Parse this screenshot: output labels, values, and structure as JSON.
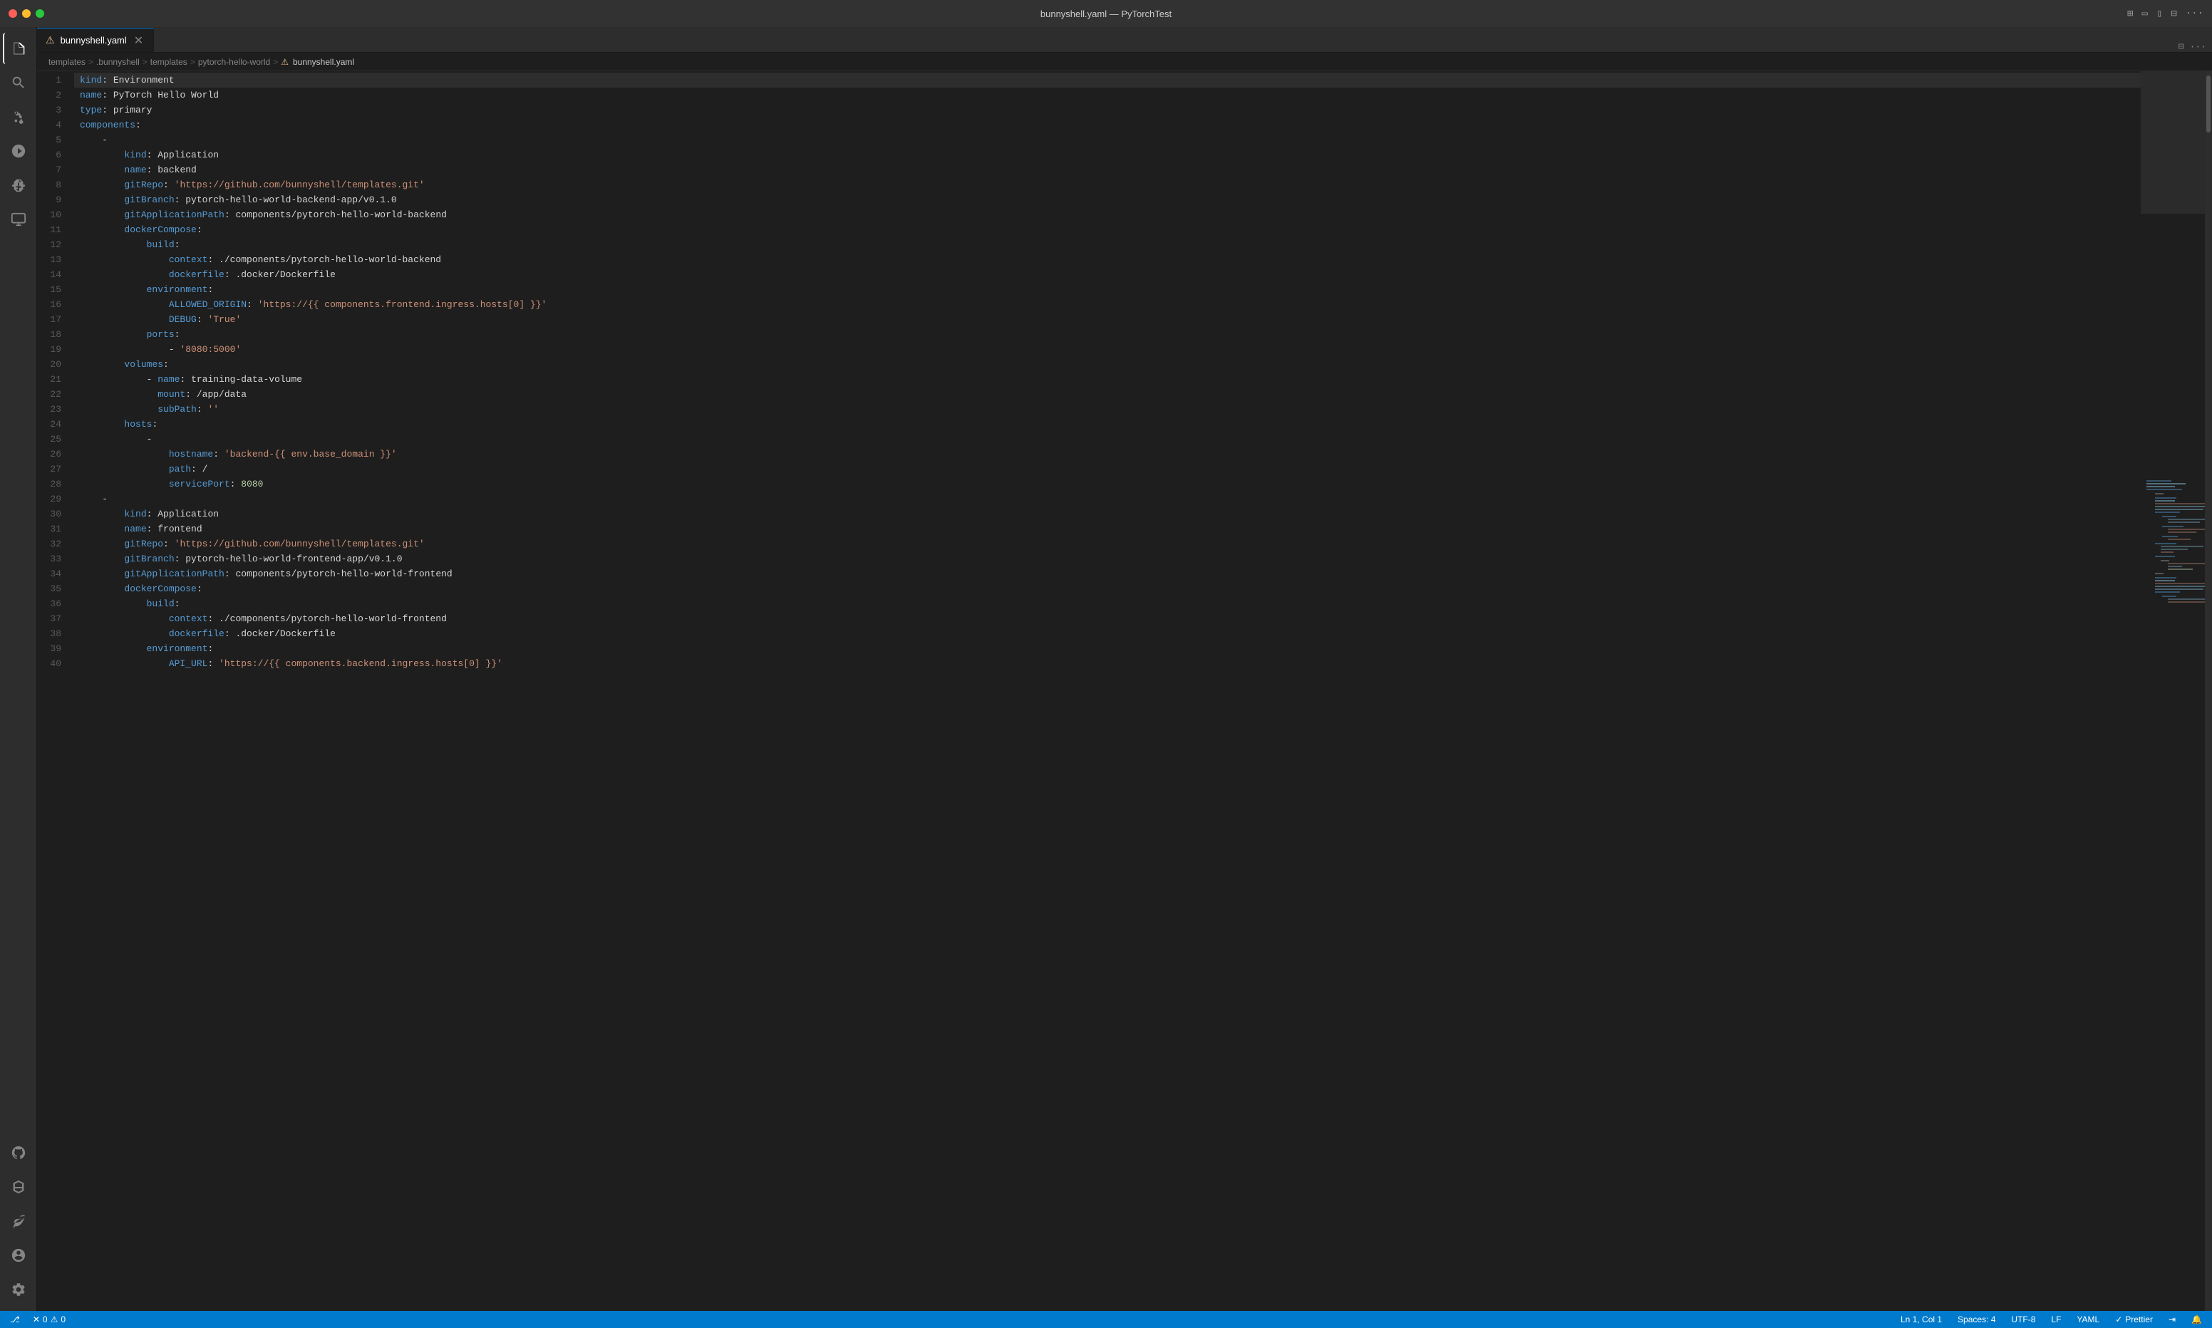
{
  "titlebar": {
    "title": "bunnyshell.yaml — PyTorchTest",
    "traffic_lights": [
      "red",
      "yellow",
      "green"
    ]
  },
  "tabs": [
    {
      "label": "bunnyshell.yaml",
      "warning": true,
      "active": true,
      "closable": true
    }
  ],
  "breadcrumb": {
    "items": [
      "templates",
      ".bunnyshell",
      "templates",
      "pytorch-hello-world",
      "bunnyshell.yaml"
    ],
    "separators": [
      ">",
      ">",
      ">",
      ">"
    ]
  },
  "editor": {
    "filename": "bunnyshell.yaml",
    "lines": [
      {
        "num": 1,
        "tokens": [
          {
            "t": "k",
            "v": "kind"
          },
          {
            "t": "p",
            "v": ": "
          },
          {
            "t": "plain",
            "v": "Environment"
          }
        ]
      },
      {
        "num": 2,
        "tokens": [
          {
            "t": "k",
            "v": "name"
          },
          {
            "t": "p",
            "v": ": "
          },
          {
            "t": "plain",
            "v": "PyTorch Hello World"
          }
        ]
      },
      {
        "num": 3,
        "tokens": [
          {
            "t": "k",
            "v": "type"
          },
          {
            "t": "p",
            "v": ": "
          },
          {
            "t": "plain",
            "v": "primary"
          }
        ]
      },
      {
        "num": 4,
        "tokens": [
          {
            "t": "k",
            "v": "components"
          },
          {
            "t": "p",
            "v": ":"
          }
        ]
      },
      {
        "num": 5,
        "tokens": [
          {
            "t": "p",
            "v": "    - "
          }
        ]
      },
      {
        "num": 6,
        "tokens": [
          {
            "t": "p",
            "v": "        "
          },
          {
            "t": "k",
            "v": "kind"
          },
          {
            "t": "p",
            "v": ": "
          },
          {
            "t": "plain",
            "v": "Application"
          }
        ]
      },
      {
        "num": 7,
        "tokens": [
          {
            "t": "p",
            "v": "        "
          },
          {
            "t": "k",
            "v": "name"
          },
          {
            "t": "p",
            "v": ": "
          },
          {
            "t": "plain",
            "v": "backend"
          }
        ]
      },
      {
        "num": 8,
        "tokens": [
          {
            "t": "p",
            "v": "        "
          },
          {
            "t": "k",
            "v": "gitRepo"
          },
          {
            "t": "p",
            "v": ": "
          },
          {
            "t": "s",
            "v": "'https://github.com/bunnyshell/templates.git'"
          }
        ]
      },
      {
        "num": 9,
        "tokens": [
          {
            "t": "p",
            "v": "        "
          },
          {
            "t": "k",
            "v": "gitBranch"
          },
          {
            "t": "p",
            "v": ": "
          },
          {
            "t": "plain",
            "v": "pytorch-hello-world-backend-app/v0.1.0"
          }
        ]
      },
      {
        "num": 10,
        "tokens": [
          {
            "t": "p",
            "v": "        "
          },
          {
            "t": "k",
            "v": "gitApplicationPath"
          },
          {
            "t": "p",
            "v": ": "
          },
          {
            "t": "plain",
            "v": "components/pytorch-hello-world-backend"
          }
        ]
      },
      {
        "num": 11,
        "tokens": [
          {
            "t": "p",
            "v": "        "
          },
          {
            "t": "k",
            "v": "dockerCompose"
          },
          {
            "t": "p",
            "v": ":"
          }
        ]
      },
      {
        "num": 12,
        "tokens": [
          {
            "t": "p",
            "v": "            "
          },
          {
            "t": "k",
            "v": "build"
          },
          {
            "t": "p",
            "v": ":"
          }
        ]
      },
      {
        "num": 13,
        "tokens": [
          {
            "t": "p",
            "v": "                "
          },
          {
            "t": "k",
            "v": "context"
          },
          {
            "t": "p",
            "v": ": "
          },
          {
            "t": "plain",
            "v": "./components/pytorch-hello-world-backend"
          }
        ]
      },
      {
        "num": 14,
        "tokens": [
          {
            "t": "p",
            "v": "                "
          },
          {
            "t": "k",
            "v": "dockerfile"
          },
          {
            "t": "p",
            "v": ": "
          },
          {
            "t": "plain",
            "v": ".docker/Dockerfile"
          }
        ]
      },
      {
        "num": 15,
        "tokens": [
          {
            "t": "p",
            "v": "            "
          },
          {
            "t": "k",
            "v": "environment"
          },
          {
            "t": "p",
            "v": ":"
          }
        ]
      },
      {
        "num": 16,
        "tokens": [
          {
            "t": "p",
            "v": "                "
          },
          {
            "t": "k",
            "v": "ALLOWED_ORIGIN"
          },
          {
            "t": "p",
            "v": ": "
          },
          {
            "t": "s",
            "v": "'https://{{ components.frontend.ingress.hosts[0] }}'"
          }
        ]
      },
      {
        "num": 17,
        "tokens": [
          {
            "t": "p",
            "v": "                "
          },
          {
            "t": "k",
            "v": "DEBUG"
          },
          {
            "t": "p",
            "v": ": "
          },
          {
            "t": "s",
            "v": "'True'"
          }
        ]
      },
      {
        "num": 18,
        "tokens": [
          {
            "t": "p",
            "v": "            "
          },
          {
            "t": "k",
            "v": "ports"
          },
          {
            "t": "p",
            "v": ":"
          }
        ]
      },
      {
        "num": 19,
        "tokens": [
          {
            "t": "p",
            "v": "                "
          },
          {
            "t": "p",
            "v": "- "
          },
          {
            "t": "s",
            "v": "'8080:5000'"
          }
        ]
      },
      {
        "num": 20,
        "tokens": [
          {
            "t": "p",
            "v": "        "
          },
          {
            "t": "k",
            "v": "volumes"
          },
          {
            "t": "p",
            "v": ":"
          }
        ]
      },
      {
        "num": 21,
        "tokens": [
          {
            "t": "p",
            "v": "            "
          },
          {
            "t": "p",
            "v": "- "
          },
          {
            "t": "k",
            "v": "name"
          },
          {
            "t": "p",
            "v": ": "
          },
          {
            "t": "plain",
            "v": "training-data-volume"
          }
        ]
      },
      {
        "num": 22,
        "tokens": [
          {
            "t": "p",
            "v": "              "
          },
          {
            "t": "k",
            "v": "mount"
          },
          {
            "t": "p",
            "v": ": "
          },
          {
            "t": "plain",
            "v": "/app/data"
          }
        ]
      },
      {
        "num": 23,
        "tokens": [
          {
            "t": "p",
            "v": "              "
          },
          {
            "t": "k",
            "v": "subPath"
          },
          {
            "t": "p",
            "v": ": "
          },
          {
            "t": "s",
            "v": "''"
          }
        ]
      },
      {
        "num": 24,
        "tokens": [
          {
            "t": "p",
            "v": "        "
          },
          {
            "t": "k",
            "v": "hosts"
          },
          {
            "t": "p",
            "v": ":"
          }
        ]
      },
      {
        "num": 25,
        "tokens": [
          {
            "t": "p",
            "v": "            "
          },
          {
            "t": "p",
            "v": "- "
          }
        ]
      },
      {
        "num": 26,
        "tokens": [
          {
            "t": "p",
            "v": "                "
          },
          {
            "t": "k",
            "v": "hostname"
          },
          {
            "t": "p",
            "v": ": "
          },
          {
            "t": "s",
            "v": "'backend-{{ env.base_domain }}'"
          }
        ]
      },
      {
        "num": 27,
        "tokens": [
          {
            "t": "p",
            "v": "                "
          },
          {
            "t": "k",
            "v": "path"
          },
          {
            "t": "p",
            "v": ": "
          },
          {
            "t": "plain",
            "v": "/"
          }
        ]
      },
      {
        "num": 28,
        "tokens": [
          {
            "t": "p",
            "v": "                "
          },
          {
            "t": "k",
            "v": "servicePort"
          },
          {
            "t": "p",
            "v": ": "
          },
          {
            "t": "num",
            "v": "8080"
          }
        ]
      },
      {
        "num": 29,
        "tokens": [
          {
            "t": "p",
            "v": "    "
          },
          {
            "t": "p",
            "v": "- "
          }
        ]
      },
      {
        "num": 30,
        "tokens": [
          {
            "t": "p",
            "v": "        "
          },
          {
            "t": "k",
            "v": "kind"
          },
          {
            "t": "p",
            "v": ": "
          },
          {
            "t": "plain",
            "v": "Application"
          }
        ]
      },
      {
        "num": 31,
        "tokens": [
          {
            "t": "p",
            "v": "        "
          },
          {
            "t": "k",
            "v": "name"
          },
          {
            "t": "p",
            "v": ": "
          },
          {
            "t": "plain",
            "v": "frontend"
          }
        ]
      },
      {
        "num": 32,
        "tokens": [
          {
            "t": "p",
            "v": "        "
          },
          {
            "t": "k",
            "v": "gitRepo"
          },
          {
            "t": "p",
            "v": ": "
          },
          {
            "t": "s",
            "v": "'https://github.com/bunnyshell/templates.git'"
          }
        ]
      },
      {
        "num": 33,
        "tokens": [
          {
            "t": "p",
            "v": "        "
          },
          {
            "t": "k",
            "v": "gitBranch"
          },
          {
            "t": "p",
            "v": ": "
          },
          {
            "t": "plain",
            "v": "pytorch-hello-world-frontend-app/v0.1.0"
          }
        ]
      },
      {
        "num": 34,
        "tokens": [
          {
            "t": "p",
            "v": "        "
          },
          {
            "t": "k",
            "v": "gitApplicationPath"
          },
          {
            "t": "p",
            "v": ": "
          },
          {
            "t": "plain",
            "v": "components/pytorch-hello-world-frontend"
          }
        ]
      },
      {
        "num": 35,
        "tokens": [
          {
            "t": "p",
            "v": "        "
          },
          {
            "t": "k",
            "v": "dockerCompose"
          },
          {
            "t": "p",
            "v": ":"
          }
        ]
      },
      {
        "num": 36,
        "tokens": [
          {
            "t": "p",
            "v": "            "
          },
          {
            "t": "k",
            "v": "build"
          },
          {
            "t": "p",
            "v": ":"
          }
        ]
      },
      {
        "num": 37,
        "tokens": [
          {
            "t": "p",
            "v": "                "
          },
          {
            "t": "k",
            "v": "context"
          },
          {
            "t": "p",
            "v": ": "
          },
          {
            "t": "plain",
            "v": "./components/pytorch-hello-world-frontend"
          }
        ]
      },
      {
        "num": 38,
        "tokens": [
          {
            "t": "p",
            "v": "                "
          },
          {
            "t": "k",
            "v": "dockerfile"
          },
          {
            "t": "p",
            "v": ": "
          },
          {
            "t": "plain",
            "v": ".docker/Dockerfile"
          }
        ]
      },
      {
        "num": 39,
        "tokens": [
          {
            "t": "p",
            "v": "            "
          },
          {
            "t": "k",
            "v": "environment"
          },
          {
            "t": "p",
            "v": ":"
          }
        ]
      },
      {
        "num": 40,
        "tokens": [
          {
            "t": "p",
            "v": "                "
          },
          {
            "t": "k",
            "v": "API_URL"
          },
          {
            "t": "p",
            "v": ": "
          },
          {
            "t": "s",
            "v": "'https://{{ components.backend.ingress.hosts[0] }}'"
          }
        ]
      }
    ]
  },
  "status_bar": {
    "left": {
      "branch_icon": "⎇",
      "branch": "",
      "errors": "0",
      "warnings": "0"
    },
    "right": {
      "position": "Ln 1, Col 1",
      "spaces": "Spaces: 4",
      "encoding": "UTF-8",
      "eol": "LF",
      "language": "YAML",
      "prettier_icon": "✓",
      "prettier": "Prettier"
    }
  },
  "activity_bar": {
    "top_icons": [
      "files",
      "search",
      "source-control",
      "run",
      "extensions",
      "remote-explorer"
    ],
    "bottom_icons": [
      "github",
      "docker",
      "leaf-icon",
      "account",
      "settings"
    ]
  }
}
